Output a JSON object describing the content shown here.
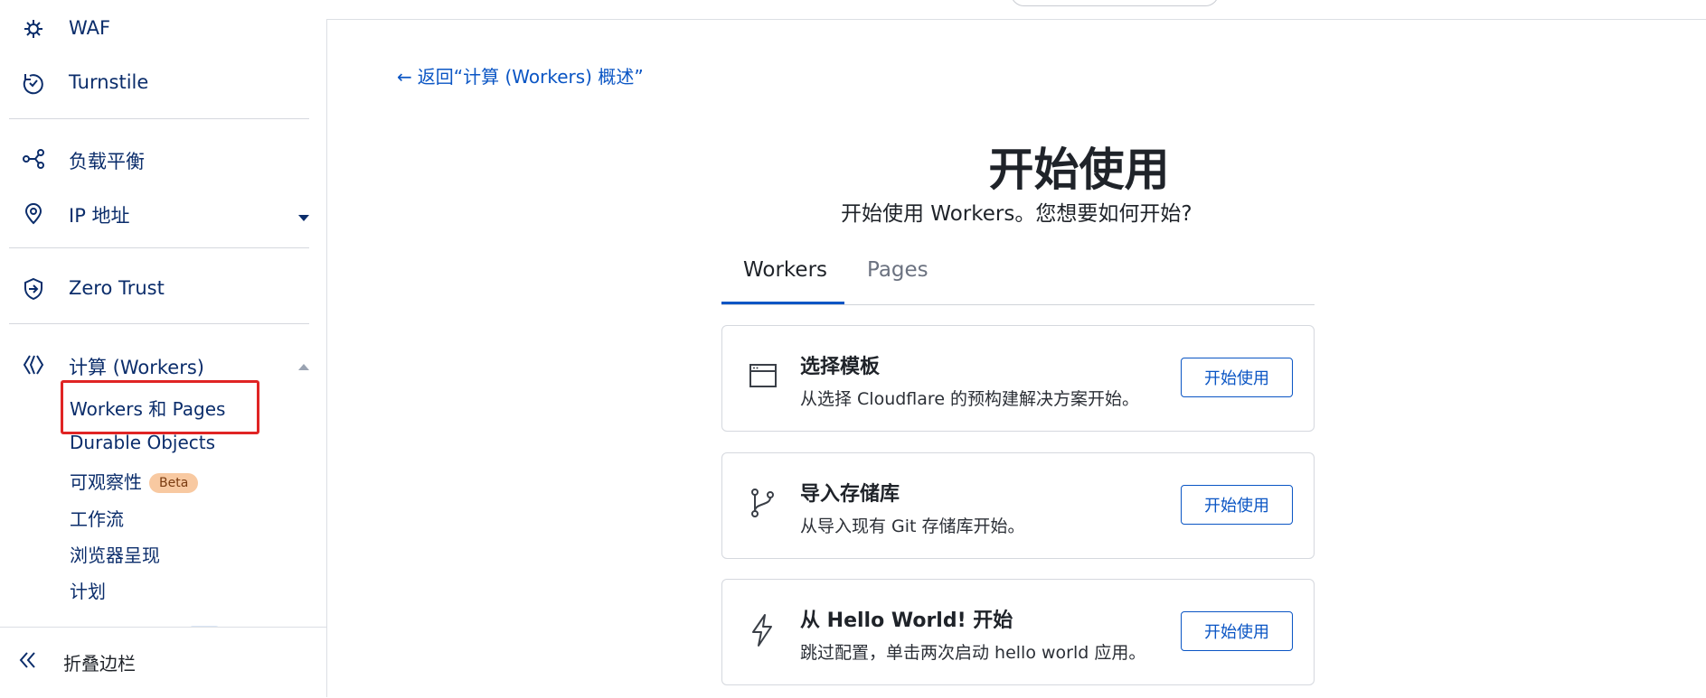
{
  "sidebar": {
    "items": [
      {
        "label": "WAF",
        "icon": "gear-shield-icon"
      },
      {
        "label": "Turnstile",
        "icon": "turnstile-icon"
      },
      {
        "label": "负载平衡",
        "icon": "load-balancer-icon"
      },
      {
        "label": "IP 地址",
        "icon": "location-pin-icon"
      },
      {
        "label": "Zero Trust",
        "icon": "zero-trust-icon"
      },
      {
        "label": "计算 (Workers)",
        "icon": "workers-icon"
      }
    ],
    "subitems": [
      {
        "label": "Workers 和 Pages"
      },
      {
        "label": "Durable Objects"
      },
      {
        "label": "可观察性",
        "badge": "Beta"
      },
      {
        "label": "工作流"
      },
      {
        "label": "浏览器呈现"
      },
      {
        "label": "计划"
      }
    ],
    "collapse_label": "折叠边栏"
  },
  "main": {
    "back_link": "返回“计算 (Workers) 概述”",
    "title": "开始使用",
    "subtitle": "开始使用 Workers。您想要如何开始?",
    "tabs": [
      {
        "label": "Workers",
        "active": true
      },
      {
        "label": "Pages",
        "active": false
      }
    ],
    "cards": [
      {
        "icon": "browser-window-icon",
        "title": "选择模板",
        "description": "从选择 Cloudflare 的预构建解决方案开始。",
        "button": "开始使用"
      },
      {
        "icon": "git-branch-icon",
        "title": "导入存储库",
        "description": "从导入现有 Git 存储库开始。",
        "button": "开始使用"
      },
      {
        "icon": "lightning-icon",
        "title": "从 Hello World! 开始",
        "description": "跳过配置，单击两次启动 hello world 应用。",
        "button": "开始使用"
      }
    ]
  },
  "colors": {
    "accent": "#0a55c4",
    "nav_text": "#0b2d6b",
    "highlight": "#e02424",
    "badge_bg": "#f8c9a1"
  }
}
